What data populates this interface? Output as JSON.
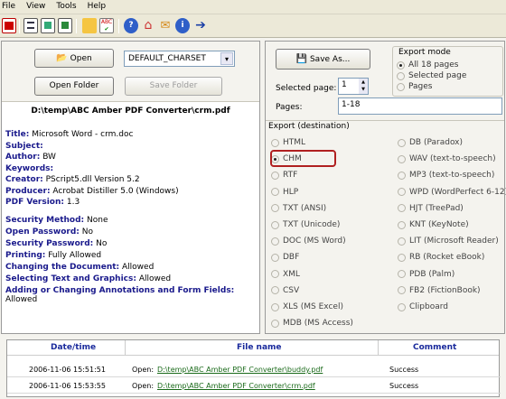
{
  "menu": [
    "File",
    "View",
    "Tools",
    "Help"
  ],
  "left": {
    "open_label": "Open",
    "charset_value": "DEFAULT_CHARSET",
    "open_folder_label": "Open Folder",
    "save_folder_label": "Save Folder",
    "file_path": "D:\\temp\\ABC Amber PDF Converter\\crm.pdf",
    "info": [
      {
        "label": "Title:",
        "value": "Microsoft Word - crm.doc"
      },
      {
        "label": "Subject:",
        "value": ""
      },
      {
        "label": "Author:",
        "value": "BW"
      },
      {
        "label": "Keywords:",
        "value": ""
      },
      {
        "label": "Creator:",
        "value": "PScript5.dll Version 5.2"
      },
      {
        "label": "Producer:",
        "value": "Acrobat Distiller 5.0 (Windows)"
      },
      {
        "label": "PDF Version:",
        "value": "1.3"
      }
    ],
    "security": [
      {
        "label": "Security Method:",
        "value": "None"
      },
      {
        "label": "Open Password:",
        "value": "No"
      },
      {
        "label": "Security Password:",
        "value": "No"
      },
      {
        "label": "Printing:",
        "value": "Fully Allowed"
      },
      {
        "label": "Changing the Document:",
        "value": "Allowed"
      },
      {
        "label": "Selecting Text and Graphics:",
        "value": "Allowed"
      },
      {
        "label": "Adding or Changing Annotations and Form Fields:",
        "value": ""
      }
    ],
    "annotations_value": "Allowed"
  },
  "right": {
    "save_as_label": "Save As...",
    "export_mode_title": "Export mode",
    "export_modes": [
      "All 18 pages",
      "Selected page",
      "Pages"
    ],
    "selected_page_label": "Selected page:",
    "selected_page_value": "1",
    "pages_label": "Pages:",
    "pages_value": "1-18",
    "export_dest_title": "Export (destination)",
    "formats_left": [
      "HTML",
      "CHM",
      "RTF",
      "HLP",
      "TXT (ANSI)",
      "TXT (Unicode)",
      "DOC (MS Word)",
      "DBF",
      "XML",
      "CSV",
      "XLS (MS Excel)",
      "MDB (MS Access)"
    ],
    "formats_right": [
      "DB (Paradox)",
      "WAV (text-to-speech)",
      "MP3 (text-to-speech)",
      "WPD (WordPerfect 6-12)",
      "HJT (TreePad)",
      "KNT (KeyNote)",
      "LIT (Microsoft Reader)",
      "RB (Rocket eBook)",
      "PDB (Palm)",
      "FB2 (FictionBook)",
      "Clipboard"
    ],
    "selected_format": "CHM"
  },
  "log": {
    "headers": [
      "Date/time",
      "File name",
      "Comment"
    ],
    "rows": [
      {
        "datetime": "2006-11-06 15:51:51",
        "prefix": "Open:",
        "file": "D:\\temp\\ABC Amber PDF Converter\\buddy.pdf",
        "comment": "Success"
      },
      {
        "datetime": "2006-11-06 15:53:55",
        "prefix": "Open:",
        "file": "D:\\temp\\ABC Amber PDF Converter\\crm.pdf",
        "comment": "Success"
      }
    ]
  }
}
